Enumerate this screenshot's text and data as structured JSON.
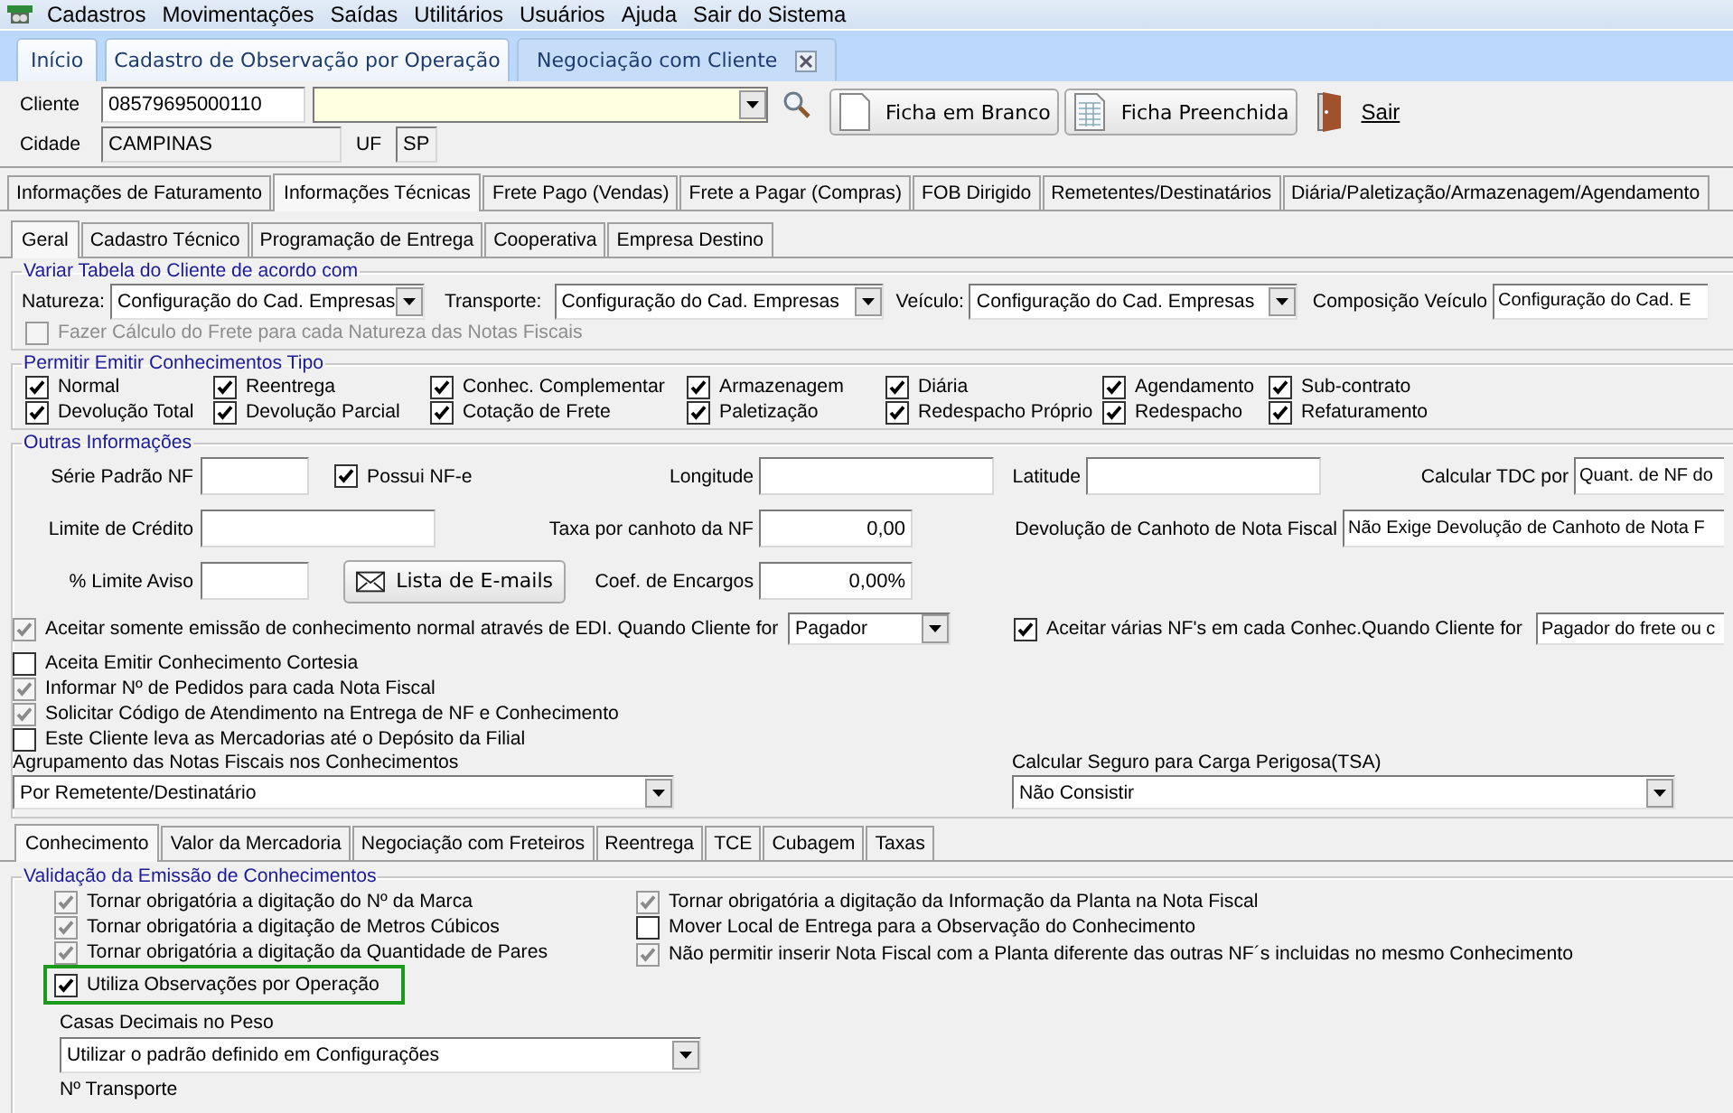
{
  "menu": [
    {
      "label": "Cadastros"
    },
    {
      "label": "Movimentações"
    },
    {
      "label": "Saídas"
    },
    {
      "label": "Utilitários"
    },
    {
      "label": "Usuários"
    },
    {
      "label": "Ajuda"
    },
    {
      "label": "Sair do Sistema"
    }
  ],
  "doc_tabs": [
    {
      "label": "Início",
      "selected": false,
      "closable": false
    },
    {
      "label": "Cadastro de Observação por Operação",
      "selected": false,
      "closable": false
    },
    {
      "label": "Negociação com Cliente",
      "selected": true,
      "closable": true
    }
  ],
  "header": {
    "client_label": "Cliente",
    "client_code": "08579695000110",
    "city_label": "Cidade",
    "city": "CAMPINAS",
    "uf_label": "UF",
    "uf": "SP",
    "buttons": [
      {
        "label": "Ficha em Branco",
        "kind": "blank"
      },
      {
        "label": "Ficha Preenchida",
        "kind": "filled"
      }
    ],
    "exit": "Sair"
  },
  "main_tabs": [
    {
      "label": "Informações de Faturamento",
      "selected": false
    },
    {
      "label": "Informações Técnicas",
      "selected": true
    },
    {
      "label": "Frete Pago (Vendas)",
      "selected": false
    },
    {
      "label": "Frete a Pagar (Compras)",
      "selected": false
    },
    {
      "label": "FOB Dirigido",
      "selected": false
    },
    {
      "label": "Remetentes/Destinatários",
      "selected": false
    },
    {
      "label": "Diária/Paletização/Armazenagem/Agendamento",
      "selected": false
    }
  ],
  "sub_tabs": [
    {
      "label": "Geral",
      "selected": true
    },
    {
      "label": "Cadastro Técnico",
      "selected": false
    },
    {
      "label": "Programação de Entrega",
      "selected": false
    },
    {
      "label": "Cooperativa",
      "selected": false
    },
    {
      "label": "Empresa Destino",
      "selected": false
    }
  ],
  "variar": {
    "title": "Variar Tabela do Cliente de acordo com",
    "combos": [
      {
        "label": "Natureza:",
        "value": "Configuração do Cad. Empresas"
      },
      {
        "label": "Transporte:",
        "value": "Configuração do Cad. Empresas"
      },
      {
        "label": "Veículo:",
        "value": "Configuração do Cad. Empresas"
      },
      {
        "label": "Composição Veículo",
        "value": "Configuração do Cad. E"
      }
    ],
    "check": {
      "label": "Fazer Cálculo do Frete para cada Natureza das Notas Fiscais",
      "checked": false,
      "disabled": true,
      "dimmed": true
    }
  },
  "permitir": {
    "title": "Permitir Emitir Conhecimentos Tipo",
    "items": [
      {
        "label": "Normal",
        "checked": true
      },
      {
        "label": "Reentrega",
        "checked": true
      },
      {
        "label": "Conhec. Complementar",
        "checked": true
      },
      {
        "label": "Armazenagem",
        "checked": true
      },
      {
        "label": "Diária",
        "checked": true
      },
      {
        "label": "Agendamento",
        "checked": true
      },
      {
        "label": "Sub-contrato",
        "checked": true
      },
      {
        "label": "Devolução Total",
        "checked": true
      },
      {
        "label": "Devolução Parcial",
        "checked": true
      },
      {
        "label": "Cotação de Frete",
        "checked": true
      },
      {
        "label": "Paletização",
        "checked": true
      },
      {
        "label": "Redespacho Próprio",
        "checked": true
      },
      {
        "label": "Redespacho",
        "checked": true
      },
      {
        "label": "Refaturamento",
        "checked": true
      }
    ]
  },
  "outras": {
    "title": "Outras Informações",
    "rows": [
      {
        "items": [
          {
            "kind": "label",
            "text": "Série Padrão NF"
          },
          {
            "kind": "field"
          },
          {
            "kind": "checkbox",
            "label": "Possui NF-e",
            "checked": true,
            "disabled": false
          },
          {
            "kind": "label",
            "text": "Longitude"
          },
          {
            "kind": "field"
          },
          {
            "kind": "label",
            "text": "Latitude"
          },
          {
            "kind": "field"
          },
          {
            "kind": "label",
            "text": "Calcular TDC por"
          },
          {
            "kind": "combo",
            "value": "Quant. de NF do"
          }
        ]
      },
      {
        "items": [
          {
            "kind": "label",
            "text": "Limite de Crédito"
          },
          {
            "kind": "field"
          },
          {
            "kind": "label",
            "text": "Taxa por canhoto da NF"
          },
          {
            "kind": "number_field",
            "value": "0,00"
          },
          {
            "kind": "label",
            "text": "Devolução de Canhoto de Nota Fiscal"
          },
          {
            "kind": "combo",
            "value": "Não Exige Devolução de Canhoto de Nota F"
          }
        ]
      },
      {
        "items": [
          {
            "kind": "label",
            "text": "% Limite Aviso"
          },
          {
            "kind": "field"
          },
          {
            "kind": "button",
            "text": "Lista de E-mails"
          },
          {
            "kind": "label",
            "text": "Coef. de Encargos"
          },
          {
            "kind": "number_field",
            "value": "0,00%"
          }
        ]
      },
      {
        "items": [
          {
            "kind": "checkbox",
            "label": "Aceitar somente emissão de conhecimento normal através de EDI. Quando Cliente for",
            "checked": true,
            "disabled": true
          },
          {
            "kind": "combo",
            "value": "Pagador"
          },
          {
            "kind": "checkbox",
            "label": "Aceitar várias NF's em cada Conhec.Quando Cliente for",
            "checked": true,
            "disabled": false
          },
          {
            "kind": "combo",
            "value": "Pagador do frete ou c"
          }
        ]
      },
      {
        "items": [
          {
            "kind": "checkbox",
            "label": "Aceita Emitir Conhecimento Cortesia",
            "checked": false,
            "disabled": false
          }
        ]
      },
      {
        "items": [
          {
            "kind": "checkbox",
            "label": "Informar Nº de Pedidos para cada Nota Fiscal",
            "checked": true,
            "disabled": true
          }
        ]
      },
      {
        "items": [
          {
            "kind": "checkbox",
            "label": "Solicitar Código de Atendimento na Entrega de NF e Conhecimento",
            "checked": true,
            "disabled": true
          }
        ]
      },
      {
        "items": [
          {
            "kind": "checkbox",
            "label": "Este Cliente leva as Mercadorias até o Depósito da Filial",
            "checked": false,
            "disabled": false
          }
        ]
      },
      {
        "items": [
          {
            "kind": "label",
            "text": "Agrupamento das Notas Fiscais nos Conhecimentos"
          },
          {
            "kind": "label",
            "text": "Calcular Seguro para Carga Perigosa(TSA)"
          }
        ]
      },
      {
        "items": [
          {
            "kind": "combo",
            "value": "Por Remetente/Destinatário"
          },
          {
            "kind": "combo",
            "value": "Não Consistir"
          }
        ]
      }
    ]
  },
  "bottom_tabs": [
    {
      "label": "Conhecimento",
      "selected": true
    },
    {
      "label": "Valor da Mercadoria",
      "selected": false
    },
    {
      "label": "Negociação com Freteiros",
      "selected": false
    },
    {
      "label": "Reentrega",
      "selected": false
    },
    {
      "label": "TCE",
      "selected": false
    },
    {
      "label": "Cubagem",
      "selected": false
    },
    {
      "label": "Taxas",
      "selected": false
    }
  ],
  "validacao": {
    "title": "Validação da Emissão de Conhecimentos",
    "left": [
      {
        "label": "Tornar obrigatória a digitação do Nº da Marca",
        "checked": true,
        "disabled": true,
        "highlighted": false
      },
      {
        "label": "Tornar obrigatória a digitação de Metros Cúbicos",
        "checked": true,
        "disabled": true,
        "highlighted": false
      },
      {
        "label": "Tornar obrigatória a digitação da Quantidade de Pares",
        "checked": true,
        "disabled": true,
        "highlighted": false
      },
      {
        "label": "Utiliza Observações por Operação",
        "checked": true,
        "disabled": false,
        "highlighted": true
      }
    ],
    "right": [
      {
        "label": "Tornar obrigatória a digitação da Informação da Planta na Nota Fiscal",
        "checked": true,
        "disabled": true
      },
      {
        "label": "Mover Local de Entrega para a Observação do Conhecimento",
        "checked": false,
        "disabled": false
      },
      {
        "label": "Não permitir inserir Nota Fiscal com a Planta diferente das outras NF´s  incluidas no mesmo Conhecimento",
        "checked": true,
        "disabled": true
      }
    ],
    "decimal_label": "Casas Decimais no Peso",
    "decimal_value": "Utilizar o padrão definido em Configurações",
    "transport_label": "Nº Transporte"
  }
}
